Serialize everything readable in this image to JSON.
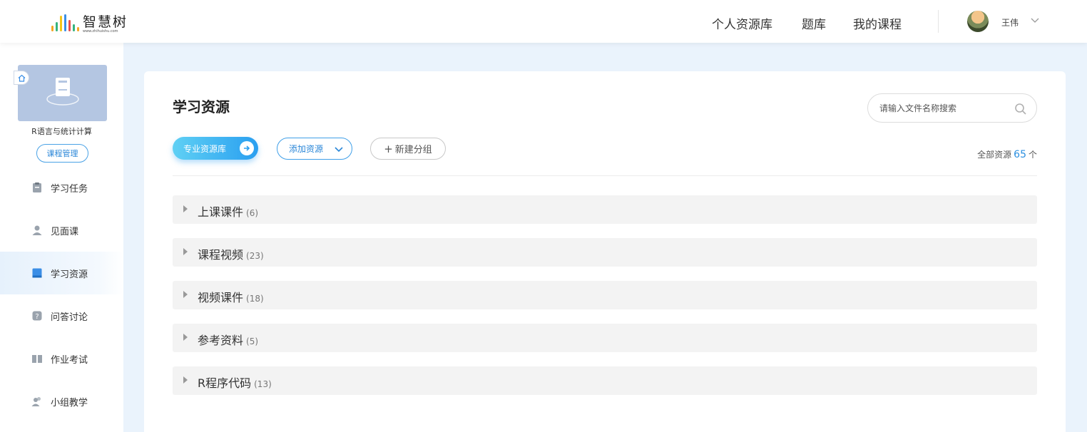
{
  "header": {
    "logo_cn": "智慧树",
    "logo_url": "www.zhihuishu.com",
    "nav": [
      "个人资源库",
      "题库",
      "我的课程"
    ],
    "user_name": "王伟"
  },
  "sidebar": {
    "course_name": "R语言与统计计算",
    "manage_label": "课程管理",
    "items": [
      {
        "label": "学习任务",
        "icon": "clipboard-icon"
      },
      {
        "label": "见面课",
        "icon": "person-icon"
      },
      {
        "label": "学习资源",
        "icon": "book-icon"
      },
      {
        "label": "问答讨论",
        "icon": "question-icon"
      },
      {
        "label": "作业考试",
        "icon": "open-book-icon"
      },
      {
        "label": "小组教学",
        "icon": "group-icon"
      }
    ],
    "active_index": 2
  },
  "main": {
    "title": "学习资源",
    "search_placeholder": "请输入文件名称搜索",
    "btn_library": "专业资源库",
    "btn_add": "添加资源",
    "btn_new_group": "新建分组",
    "total_label": "全部资源",
    "total_count": "65",
    "total_unit": "个",
    "groups": [
      {
        "name": "上课课件",
        "count": "(6)"
      },
      {
        "name": "课程视频",
        "count": "(23)"
      },
      {
        "name": "视频课件",
        "count": "(18)"
      },
      {
        "name": "参考资料",
        "count": "(5)"
      },
      {
        "name": "R程序代码",
        "count": "(13)"
      }
    ]
  },
  "colors": {
    "accent": "#2b87d8",
    "page_bg": "#eaf3fc",
    "row_bg": "#f3f3f3"
  }
}
